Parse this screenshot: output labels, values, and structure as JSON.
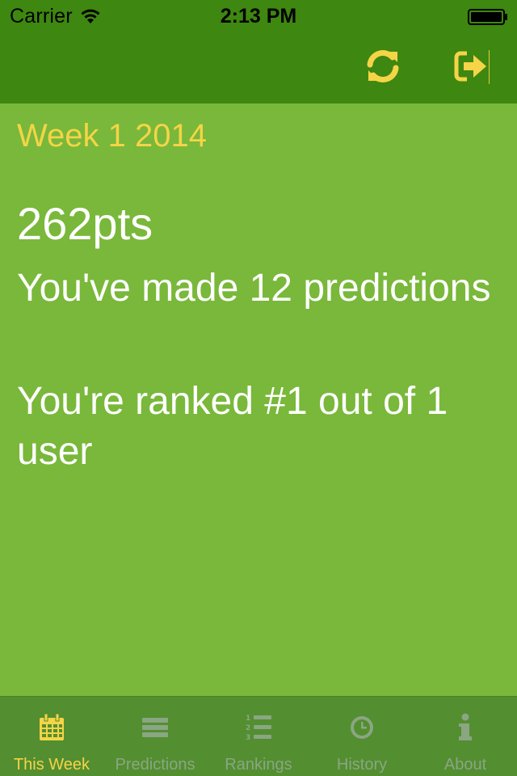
{
  "status_bar": {
    "carrier": "Carrier",
    "time": "2:13 PM",
    "wifi_icon": "wifi-icon",
    "battery_icon": "battery-icon"
  },
  "nav_bar": {
    "refresh_icon": "refresh-icon",
    "signout_icon": "sign-out-icon"
  },
  "content": {
    "week_title": "Week 1 2014",
    "points": "262pts",
    "predictions_text": "You've made 12 predictions",
    "rank_text": "You're ranked #1 out of 1 user"
  },
  "tabs": [
    {
      "label": "This Week",
      "icon": "calendar-icon",
      "active": true
    },
    {
      "label": "Predictions",
      "icon": "list-icon",
      "active": false
    },
    {
      "label": "Rankings",
      "icon": "ordered-list-icon",
      "active": false
    },
    {
      "label": "History",
      "icon": "clock-icon",
      "active": false
    },
    {
      "label": "About",
      "icon": "info-icon",
      "active": false
    }
  ],
  "colors": {
    "background": "#79b83a",
    "header": "#3e8710",
    "accent": "#f5d447",
    "tab_bar": "#538e30",
    "tab_inactive": "#8aa683"
  }
}
